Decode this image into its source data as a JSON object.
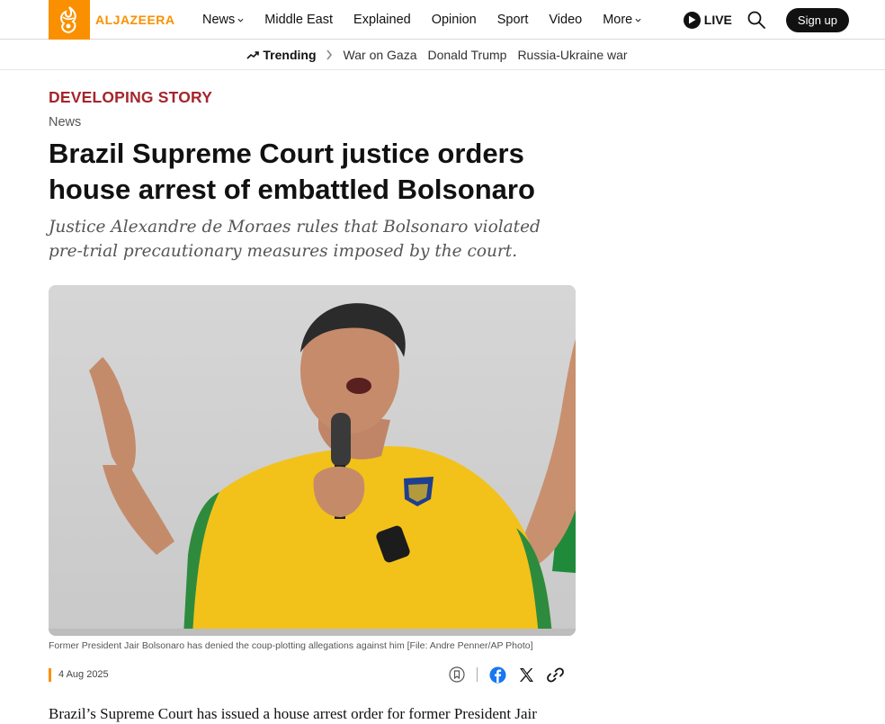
{
  "header": {
    "logo_text": "ALJAZEERA",
    "nav": [
      {
        "label": "News",
        "dropdown": true
      },
      {
        "label": "Middle East",
        "dropdown": false
      },
      {
        "label": "Explained",
        "dropdown": false
      },
      {
        "label": "Opinion",
        "dropdown": false
      },
      {
        "label": "Sport",
        "dropdown": false
      },
      {
        "label": "Video",
        "dropdown": false
      },
      {
        "label": "More",
        "dropdown": true
      }
    ],
    "live_label": "LIVE",
    "signup_label": "Sign up",
    "brand_color": "#fa9000"
  },
  "trending": {
    "label": "Trending",
    "links": [
      "War on Gaza",
      "Donald Trump",
      "Russia-Ukraine war"
    ]
  },
  "article": {
    "kicker": "DEVELOPING STORY",
    "section": "News",
    "headline": "Brazil Supreme Court justice orders house arrest of embattled Bolsonaro",
    "dek": "Justice Alexandre de Moraes rules that Bolsonaro violated pre-trial precautionary measures imposed by the court.",
    "caption": "Former President Jair Bolsonaro has denied the coup-plotting allegations against him [File: Andre Penner/AP Photo]",
    "date": "4 Aug 2025",
    "body_start": "Brazil’s Supreme Court has issued a house arrest order for former President Jair",
    "kicker_color": "#a4262c"
  },
  "icons": {
    "share": [
      "bookmark-icon",
      "facebook-icon",
      "x-icon",
      "link-icon"
    ]
  }
}
